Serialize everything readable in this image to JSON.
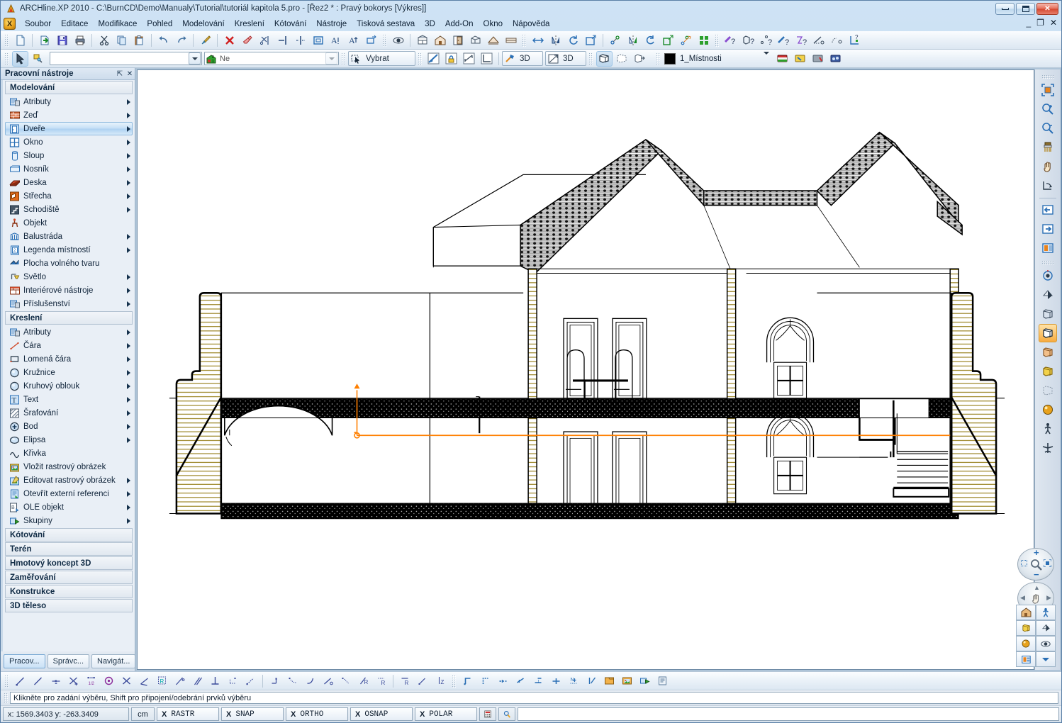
{
  "window": {
    "title": "ARCHline.XP 2010 - C:\\BurnCD\\Demo\\Manualy\\Tutorial\\tutoriál kapitola 5.pro - [Řez2 *  : Pravý bokorys [Výkres]]",
    "app_icon": "archline-logo-icon",
    "buttons": {
      "minimize": "minimize-icon",
      "maximize": "maximize-icon",
      "close": "close-icon"
    },
    "mdi_buttons": {
      "minimize": "_",
      "restore": "❐",
      "close": "✕"
    }
  },
  "menu": {
    "app_glyph": "X",
    "items": [
      "Soubor",
      "Editace",
      "Modifikace",
      "Pohled",
      "Modelování",
      "Kreslení",
      "Kótování",
      "Nástroje",
      "Tisková sestava",
      "3D",
      "Add-On",
      "Okno",
      "Nápověda"
    ]
  },
  "toolbar_row1": {
    "groups": [
      {
        "name": "file",
        "buttons": [
          "new-document-icon",
          "open-document-icon",
          "save-icon",
          "print-icon"
        ]
      },
      {
        "name": "clipboard",
        "buttons": [
          "cut-icon",
          "copy-icon",
          "paste-icon"
        ]
      },
      {
        "name": "history",
        "buttons": [
          "undo-icon",
          "redo-icon"
        ]
      },
      {
        "name": "format-painter",
        "buttons": [
          "format-painter-icon"
        ]
      },
      {
        "name": "edit-ops",
        "buttons": [
          "delete-icon",
          "erase-icon",
          "trim-icon",
          "extend-icon",
          "break-icon",
          "rectangle-select-icon",
          "text-style-a-icon",
          "text-style-a2-icon",
          "move-box-icon"
        ]
      },
      {
        "name": "view-eye",
        "buttons": [
          "eye-view-icon"
        ]
      },
      {
        "name": "storeys",
        "buttons": [
          "storey-plan-icon",
          "house-icon",
          "door-panel-icon",
          "perspective-icon",
          "gable-icon",
          "ceiling-icon"
        ]
      },
      {
        "name": "transform",
        "buttons": [
          "move-arrows-icon",
          "mirror-icon",
          "rotate-icon",
          "scale-icon"
        ]
      },
      {
        "name": "transform-copy",
        "buttons": [
          "copy-move-icon",
          "copy-mirror-icon",
          "copy-rotate-icon",
          "copy-scale-icon",
          "copy-path-icon",
          "array-icon"
        ]
      },
      {
        "name": "query",
        "buttons": [
          "measure-distance-icon",
          "measure-volume-icon",
          "measure-point-icon",
          "measure-length-icon",
          "measure-sum-icon",
          "measure-angle-icon",
          "measure-arc-icon",
          "measure-coords-icon"
        ]
      }
    ]
  },
  "toolbar_row2": {
    "select_arrow": "select-arrow-icon",
    "properties": "properties-icon",
    "layer_combo_value": "",
    "layer_combo_placeholder": "",
    "dim_combo_icon": "storey-marker-icon",
    "dim_combo_value": "Ne",
    "select_button_label": "Vybrat",
    "select_button_icon": "marquee-select-icon",
    "mode_buttons": [
      "section-tool-icon",
      "lock-tool-icon",
      "dimension-tool-icon",
      "axis-tool-icon"
    ],
    "render_buttons": [
      {
        "icon": "hammer-3d-icon",
        "label": "3D"
      },
      {
        "icon": "render-3d-icon",
        "label": "3D"
      }
    ],
    "box_buttons": [
      "box-solid-icon",
      "box-dashed-icon",
      "box-export-icon"
    ],
    "layer_swatch_color": "#000000",
    "layer_name": "1_Místnosti",
    "material_buttons": [
      "material-red-icon",
      "material-yellow-icon",
      "material-grey-icon",
      "material-blue-icon"
    ]
  },
  "left_panel": {
    "title": "Pracovní nástroje",
    "pin_icon": "pin-icon",
    "close_icon": "close-icon",
    "groups": [
      {
        "header": "Modelování",
        "items": [
          {
            "label": "Atributy",
            "icon": "attributes-icon",
            "arrow": true,
            "selected": false
          },
          {
            "label": "Zeď",
            "icon": "wall-icon",
            "arrow": true,
            "selected": false
          },
          {
            "label": "Dveře",
            "icon": "door-icon",
            "arrow": true,
            "selected": true
          },
          {
            "label": "Okno",
            "icon": "window-icon",
            "arrow": true,
            "selected": false
          },
          {
            "label": "Sloup",
            "icon": "column-icon",
            "arrow": true,
            "selected": false
          },
          {
            "label": "Nosník",
            "icon": "beam-icon",
            "arrow": true,
            "selected": false
          },
          {
            "label": "Deska",
            "icon": "slab-icon",
            "arrow": true,
            "selected": false
          },
          {
            "label": "Střecha",
            "icon": "roof-icon",
            "arrow": true,
            "selected": false
          },
          {
            "label": "Schodiště",
            "icon": "stairs-icon",
            "arrow": true,
            "selected": false
          },
          {
            "label": "Objekt",
            "icon": "object-icon",
            "arrow": false,
            "selected": false
          },
          {
            "label": "Balustráda",
            "icon": "balustrade-icon",
            "arrow": true,
            "selected": false
          },
          {
            "label": "Legenda místností",
            "icon": "room-legend-icon",
            "arrow": true,
            "selected": false
          },
          {
            "label": "Plocha volného tvaru",
            "icon": "freeform-area-icon",
            "arrow": false,
            "selected": false
          },
          {
            "label": "Světlo",
            "icon": "light-icon",
            "arrow": true,
            "selected": false
          },
          {
            "label": "Interiérové nástroje",
            "icon": "interior-tools-icon",
            "arrow": true,
            "selected": false
          },
          {
            "label": "Příslušenství",
            "icon": "accessories-icon",
            "arrow": true,
            "selected": false
          }
        ]
      },
      {
        "header": "Kreslení",
        "items": [
          {
            "label": "Atributy",
            "icon": "attributes-icon",
            "arrow": true,
            "selected": false
          },
          {
            "label": "Čára",
            "icon": "line-icon",
            "arrow": true,
            "selected": false
          },
          {
            "label": "Lomená čára",
            "icon": "polyline-icon",
            "arrow": true,
            "selected": false
          },
          {
            "label": "Kružnice",
            "icon": "circle-icon",
            "arrow": true,
            "selected": false
          },
          {
            "label": "Kruhový oblouk",
            "icon": "arc-icon",
            "arrow": true,
            "selected": false
          },
          {
            "label": "Text",
            "icon": "text-icon",
            "arrow": true,
            "selected": false
          },
          {
            "label": "Šrafování",
            "icon": "hatch-icon",
            "arrow": true,
            "selected": false
          },
          {
            "label": "Bod",
            "icon": "point-icon",
            "arrow": true,
            "selected": false
          },
          {
            "label": "Elipsa",
            "icon": "ellipse-icon",
            "arrow": true,
            "selected": false
          },
          {
            "label": "Křivka",
            "icon": "spline-icon",
            "arrow": false,
            "selected": false
          },
          {
            "label": "Vložit rastrový obrázek",
            "icon": "insert-raster-icon",
            "arrow": false,
            "selected": false
          },
          {
            "label": "Editovat rastrový obrázek",
            "icon": "edit-raster-icon",
            "arrow": true,
            "selected": false
          },
          {
            "label": "Otevřít externí referenci",
            "icon": "external-reference-icon",
            "arrow": true,
            "selected": false
          },
          {
            "label": "OLE objekt",
            "icon": "ole-object-icon",
            "arrow": true,
            "selected": false
          },
          {
            "label": "Skupiny",
            "icon": "groups-icon",
            "arrow": true,
            "selected": false
          }
        ]
      }
    ],
    "collapsed_headers": [
      "Kótování",
      "Terén",
      "Hmotový koncept 3D",
      "Zaměřování",
      "Konstrukce",
      "3D těleso"
    ],
    "tabs": [
      {
        "label": "Pracov...",
        "active": true
      },
      {
        "label": "Správc...",
        "active": false
      },
      {
        "label": "Navigát...",
        "active": false
      }
    ]
  },
  "right_toolbar": {
    "group1": [
      "zoom-extents-icon",
      "zoom-in-icon",
      "zoom-out-icon",
      "zoom-clean-icon",
      "pan-hand-icon",
      "zoom-previous-icon",
      "arrow-left-icon",
      "arrow-right-icon",
      "layout-window-icon"
    ],
    "group2": [
      "eye-view-icon",
      "shadow-icon",
      "wireframe-box-icon",
      "solid-box-icon",
      "shaded-box-icon",
      "colored-box-icon",
      "hidden-box-icon",
      "render-sphere-icon",
      "walk-icon",
      "fly-icon"
    ]
  },
  "nav_widgets": {
    "zoom_dial": {
      "plus": "+",
      "minus": "−",
      "magnifier": "magnifier-icon",
      "marquee": "marquee-icon",
      "fit": "fit-icon"
    },
    "pan_dial": {
      "up": "▲",
      "down": "▼",
      "left": "◀",
      "right": "▶",
      "hand": "hand-icon"
    },
    "grid_buttons": [
      "home-house-icon",
      "walk-person-icon",
      "wireframe-cube-icon",
      "shading-icon",
      "render-ball-icon",
      "eye-view-icon",
      "layout-window-icon",
      "dropdown-arrow-icon"
    ]
  },
  "bottom_toolbar": {
    "snap_group1": [
      "snap-endpoint-icon",
      "snap-line-icon",
      "snap-midpoint-icon",
      "snap-intersection-icon",
      "snap-half-icon",
      "snap-center-icon",
      "snap-cross-icon",
      "snap-angle-icon",
      "snap-reference-icon",
      "snap-perpendicular-point-icon",
      "snap-parallel-icon",
      "snap-perpendicular-icon",
      "snap-dotted-icon",
      "snap-nearest-icon"
    ],
    "snap_group2": [
      "snap-offset-icon",
      "snap-dotted-path-icon",
      "snap-arc-icon",
      "snap-tangent-icon",
      "snap-quadrant-icon",
      "snap-r-icon",
      "snap-r2-icon"
    ],
    "snap_group3": [
      "snap-radius-icon",
      "snap-delta-icon",
      "snap-z-icon"
    ],
    "ortho_group": [
      "ortho-corner-icon",
      "ortho-corner2-icon",
      "ortho-mid-icon",
      "ortho-end-icon",
      "ortho-slope-icon",
      "ortho-plus-icon",
      "ortho-n-icon",
      "ortho-vector-icon"
    ],
    "file_group": [
      "open-folder-icon",
      "image-file-icon",
      "group-icon",
      "list-icon"
    ]
  },
  "command_line": {
    "prompt": "Klikněte pro zadání výběru, Shift pro připojení/odebrání prvků výběru",
    "input_value": ""
  },
  "status_bar": {
    "coordinates": "x: 1569.3403  y: -263.3409",
    "unit": "cm",
    "toggles": [
      {
        "state": "X",
        "label": "RASTR"
      },
      {
        "state": "X",
        "label": "SNAP"
      },
      {
        "state": "X",
        "label": "ORTHO"
      },
      {
        "state": "X",
        "label": "OSNAP"
      },
      {
        "state": "X",
        "label": "POLAR"
      }
    ],
    "icons": [
      "calculator-icon",
      "magnifier-icon"
    ],
    "input_value": ""
  },
  "drawing": {
    "title": "Řez2 - Pravý bokorys",
    "origin_marker_color": "#ff7f00",
    "hatch_color": "#8a7000",
    "line_color": "#000000"
  }
}
